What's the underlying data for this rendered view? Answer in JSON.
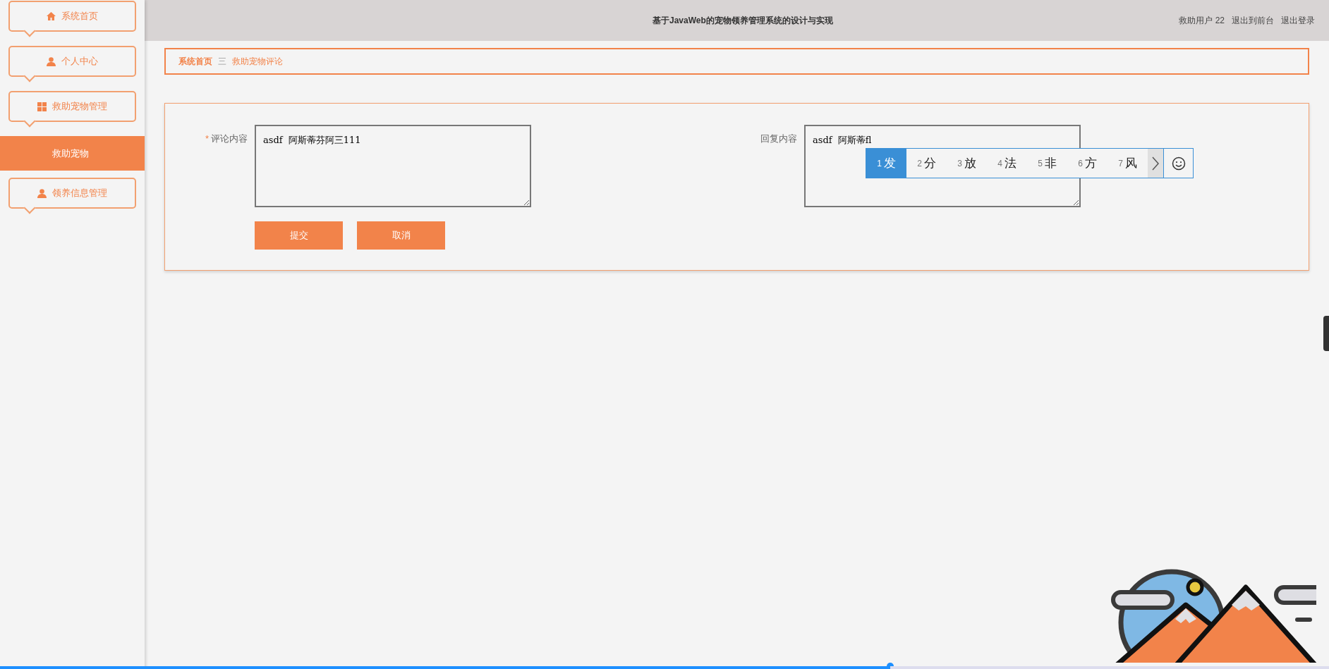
{
  "sidebar": {
    "items": [
      {
        "label": "系统首页",
        "kind": "bubble",
        "selected": false
      },
      {
        "label": "个人中心",
        "kind": "bubble",
        "selected": false
      },
      {
        "label": "救助宠物管理",
        "kind": "bubble",
        "selected": false
      },
      {
        "label": "救助宠物",
        "kind": "sub",
        "selected": true
      },
      {
        "label": "领养信息管理",
        "kind": "bubble",
        "selected": false
      }
    ]
  },
  "header": {
    "title": "基于JavaWeb的宠物领养管理系统的设计与实现",
    "user": "救助用户 22",
    "links": [
      "退出到前台",
      "退出登录"
    ]
  },
  "breadcrumb": {
    "items": [
      "系统首页",
      "救助宠物评论"
    ],
    "separator": "三"
  },
  "form": {
    "fields": [
      {
        "label": "评论内容",
        "required_mark": "*",
        "value": "asdf  阿斯蒂芬阿三111"
      },
      {
        "label": "回复内容",
        "value": "asdf  阿斯蒂fl"
      }
    ],
    "buttons": [
      "提交",
      "取消"
    ]
  },
  "ime": {
    "candidates": [
      {
        "number": "1",
        "text": "发",
        "selected": true
      },
      {
        "number": "2",
        "text": "分",
        "selected": false
      },
      {
        "number": "3",
        "text": "放",
        "selected": false
      },
      {
        "number": "4",
        "text": "法",
        "selected": false
      },
      {
        "number": "5",
        "text": "非",
        "selected": false
      },
      {
        "number": "6",
        "text": "方",
        "selected": false
      },
      {
        "number": "7",
        "text": "风",
        "selected": false
      }
    ]
  },
  "progress_bar": {
    "level": 0.67
  }
}
